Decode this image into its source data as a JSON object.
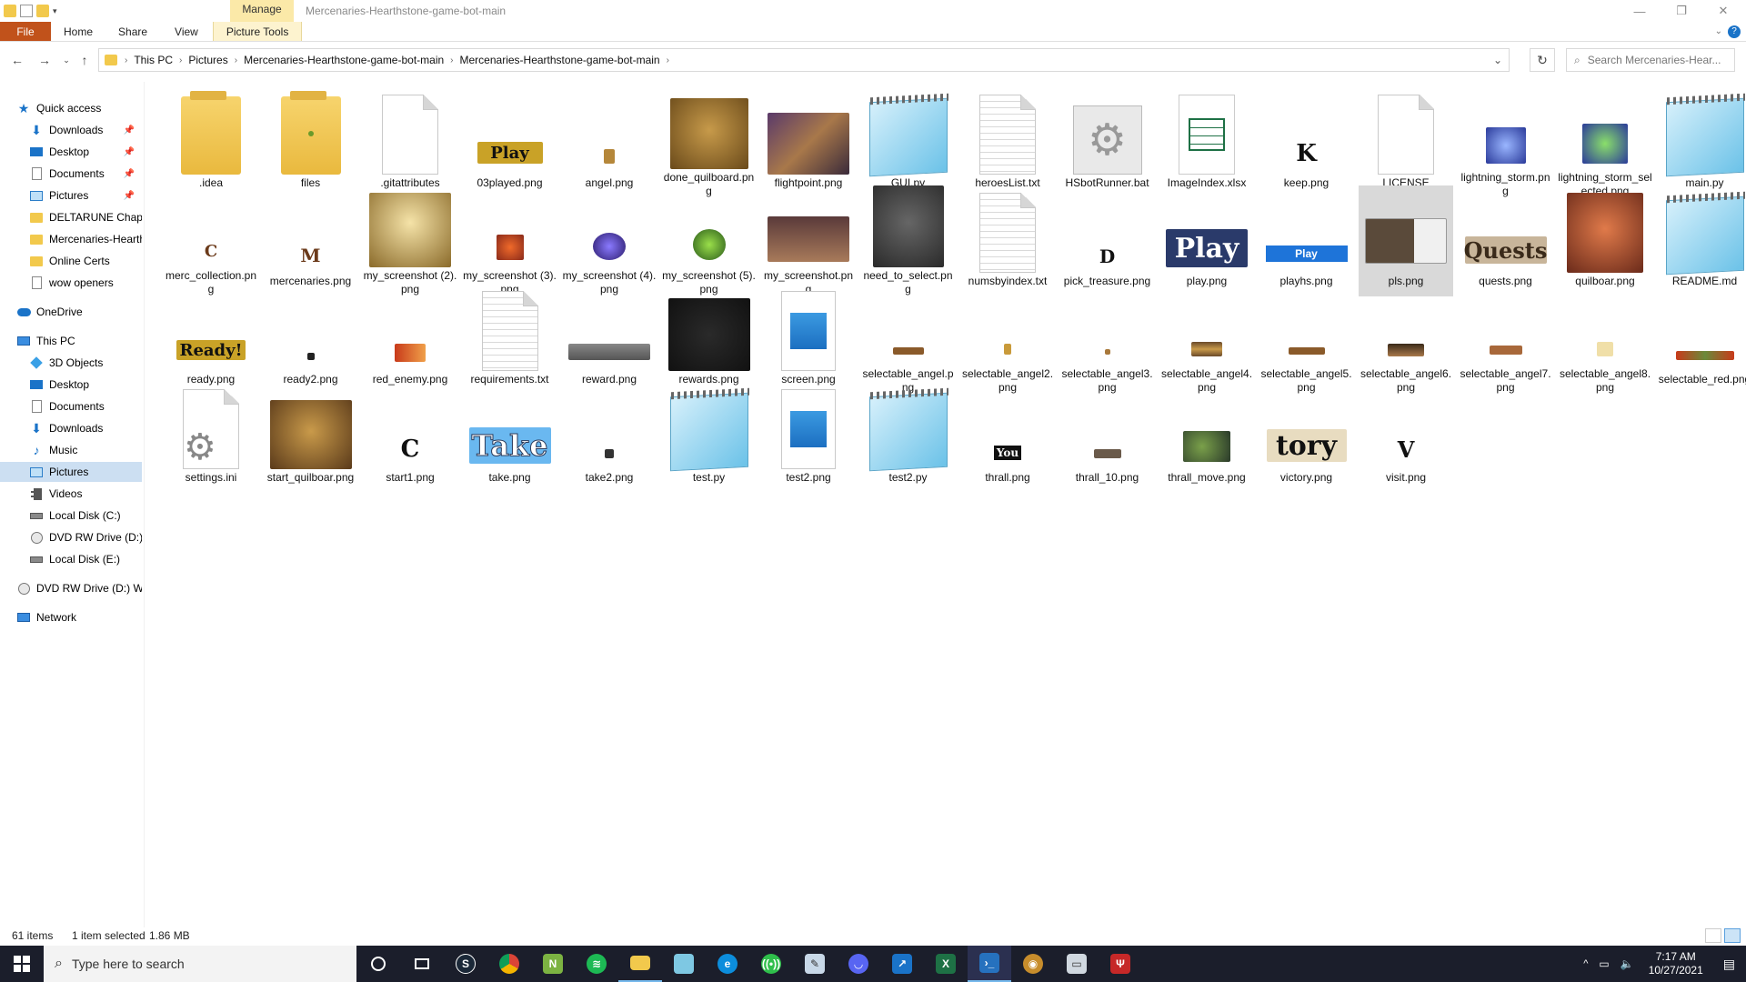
{
  "window": {
    "title": "Mercenaries-Hearthstone-game-bot-main",
    "contextual_group": "Manage"
  },
  "ribbon": {
    "tabs": [
      "File",
      "Home",
      "Share",
      "View",
      "Picture Tools"
    ]
  },
  "breadcrumb": [
    "This PC",
    "Pictures",
    "Mercenaries-Hearthstone-game-bot-main",
    "Mercenaries-Hearthstone-game-bot-main"
  ],
  "search": {
    "placeholder": "Search Mercenaries-Hear..."
  },
  "sidebar": {
    "quick_access": "Quick access",
    "quick_items": [
      "Downloads",
      "Desktop",
      "Documents",
      "Pictures",
      "DELTARUNE Chapte",
      "Mercenaries-Hearth",
      "Online Certs",
      "wow openers"
    ],
    "onedrive": "OneDrive",
    "this_pc": "This PC",
    "pc_items": [
      "3D Objects",
      "Desktop",
      "Documents",
      "Downloads",
      "Music",
      "Pictures",
      "Videos",
      "Local Disk (C:)",
      "DVD RW Drive (D:) V",
      "Local Disk (E:)"
    ],
    "dvd": "DVD RW Drive (D:) W",
    "network": "Network"
  },
  "files": [
    {
      "name": ".idea",
      "icon": "folder-icon"
    },
    {
      "name": "files",
      "icon": "folder-icon"
    },
    {
      "name": ".gitattributes",
      "icon": "document-icon"
    },
    {
      "name": "03played.png",
      "icon": "image-thumbnail",
      "thumb_text": "Play"
    },
    {
      "name": "angel.png",
      "icon": "image-thumbnail"
    },
    {
      "name": "done_quilboard.png",
      "icon": "image-thumbnail"
    },
    {
      "name": "flightpoint.png",
      "icon": "image-thumbnail"
    },
    {
      "name": "GUI.py",
      "icon": "notepad-icon"
    },
    {
      "name": "heroesList.txt",
      "icon": "text-file-icon"
    },
    {
      "name": "HSbotRunner.bat",
      "icon": "gear-file-icon"
    },
    {
      "name": "ImageIndex.xlsx",
      "icon": "excel-file-icon"
    },
    {
      "name": "keep.png",
      "icon": "image-thumbnail",
      "thumb_text": "K"
    },
    {
      "name": "LICENSE",
      "icon": "document-icon"
    },
    {
      "name": "lightning_storm.png",
      "icon": "image-thumbnail"
    },
    {
      "name": "lightning_storm_selected.png",
      "icon": "image-thumbnail"
    },
    {
      "name": "main.py",
      "icon": "notepad-icon"
    },
    {
      "name": "merc_collection.png",
      "icon": "image-thumbnail",
      "thumb_text": "C"
    },
    {
      "name": "mercenaries.png",
      "icon": "image-thumbnail",
      "thumb_text": "M"
    },
    {
      "name": "my_screenshot (2).png",
      "icon": "image-thumbnail"
    },
    {
      "name": "my_screenshot (3).png",
      "icon": "image-thumbnail"
    },
    {
      "name": "my_screenshot (4).png",
      "icon": "image-thumbnail"
    },
    {
      "name": "my_screenshot (5).png",
      "icon": "image-thumbnail"
    },
    {
      "name": "my_screenshot.png",
      "icon": "image-thumbnail"
    },
    {
      "name": "need_to_select.png",
      "icon": "image-thumbnail"
    },
    {
      "name": "numsbyindex.txt",
      "icon": "text-file-icon"
    },
    {
      "name": "pick_treasure.png",
      "icon": "image-thumbnail",
      "thumb_text": "D"
    },
    {
      "name": "play.png",
      "icon": "image-thumbnail",
      "thumb_text": "Play"
    },
    {
      "name": "playhs.png",
      "icon": "image-thumbnail",
      "thumb_text": "Play"
    },
    {
      "name": "pls.png",
      "icon": "image-thumbnail"
    },
    {
      "name": "quests.png",
      "icon": "image-thumbnail",
      "thumb_text": "Quests"
    },
    {
      "name": "quilboar.png",
      "icon": "image-thumbnail"
    },
    {
      "name": "README.md",
      "icon": "notepad-icon"
    },
    {
      "name": "ready.png",
      "icon": "image-thumbnail",
      "thumb_text": "Ready!"
    },
    {
      "name": "ready2.png",
      "icon": "image-thumbnail"
    },
    {
      "name": "red_enemy.png",
      "icon": "image-thumbnail"
    },
    {
      "name": "requirements.txt",
      "icon": "text-file-icon"
    },
    {
      "name": "reward.png",
      "icon": "image-thumbnail"
    },
    {
      "name": "rewards.png",
      "icon": "image-thumbnail"
    },
    {
      "name": "screen.png",
      "icon": "image-file-icon"
    },
    {
      "name": "selectable_angel.png",
      "icon": "image-thumbnail"
    },
    {
      "name": "selectable_angel2.png",
      "icon": "image-thumbnail"
    },
    {
      "name": "selectable_angel3.png",
      "icon": "image-thumbnail"
    },
    {
      "name": "selectable_angel4.png",
      "icon": "image-thumbnail"
    },
    {
      "name": "selectable_angel5.png",
      "icon": "image-thumbnail"
    },
    {
      "name": "selectable_angel6.png",
      "icon": "image-thumbnail"
    },
    {
      "name": "selectable_angel7.png",
      "icon": "image-thumbnail"
    },
    {
      "name": "selectable_angel8.png",
      "icon": "image-thumbnail"
    },
    {
      "name": "selectable_red.png",
      "icon": "image-thumbnail"
    },
    {
      "name": "settings.ini",
      "icon": "settings-file-icon"
    },
    {
      "name": "start_quilboar.png",
      "icon": "image-thumbnail"
    },
    {
      "name": "start1.png",
      "icon": "image-thumbnail",
      "thumb_text": "C"
    },
    {
      "name": "take.png",
      "icon": "image-thumbnail",
      "thumb_text": "Take"
    },
    {
      "name": "take2.png",
      "icon": "image-thumbnail"
    },
    {
      "name": "test.py",
      "icon": "notepad-icon"
    },
    {
      "name": "test2.png",
      "icon": "image-file-icon"
    },
    {
      "name": "test2.py",
      "icon": "notepad-icon"
    },
    {
      "name": "thrall.png",
      "icon": "image-thumbnail",
      "thumb_text": "You"
    },
    {
      "name": "thrall_10.png",
      "icon": "image-thumbnail"
    },
    {
      "name": "thrall_move.png",
      "icon": "image-thumbnail"
    },
    {
      "name": "victory.png",
      "icon": "image-thumbnail",
      "thumb_text": "tory"
    },
    {
      "name": "visit.png",
      "icon": "image-thumbnail",
      "thumb_text": "V"
    }
  ],
  "selected_file": "pls.png",
  "status": {
    "items": "61 items",
    "selection": "1 item selected",
    "size": "1.86 MB"
  },
  "taskbar": {
    "search_placeholder": "Type here to search",
    "time": "7:17 AM",
    "date": "10/27/2021"
  }
}
